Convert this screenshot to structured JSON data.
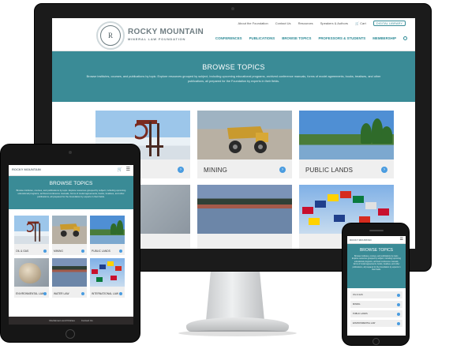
{
  "desktop": {
    "topbar": [
      "About the Foundation",
      "Contact Us",
      "Resources",
      "Speakers & Authors",
      "Cart"
    ],
    "digital_library": "DIGITAL LIBRARY",
    "logo": {
      "title": "ROCKY MOUNTAIN",
      "subtitle": "MINERAL LAW FOUNDATION",
      "monogram": "R"
    },
    "nav": [
      "CONFERENCES",
      "PUBLICATIONS",
      "BROWSE TOPICS",
      "PROFESSORS & STUDENTS",
      "MEMBERSHIP"
    ],
    "hero": {
      "title": "BROWSE TOPICS",
      "text": "Browse institutes, courses, and publications by topic. Explore resources grouped by subject, including upcoming educational programs, archived conference manuals, forms of model agreements, books, treatises, and other publications, all prepared for the Foundation by experts in their fields."
    },
    "cards": [
      {
        "label": ""
      },
      {
        "label": "MINING"
      },
      {
        "label": "PUBLIC LANDS"
      },
      {
        "label": ""
      },
      {
        "label": ""
      },
      {
        "label": ""
      }
    ]
  },
  "tablet": {
    "logo": "ROCKY MOUNTAIN",
    "hero": {
      "title": "BROWSE TOPICS",
      "text": "Browse institutes, courses, and publications by topic. Explore resources grouped by subject, including upcoming educational programs, archived conference manuals, forms of model agreements, books, treatises, and other publications, all prepared for the Foundation by experts in their fields."
    },
    "cards": [
      "OIL & GAS",
      "MINING",
      "PUBLIC LANDS",
      "ENVIRONMENTAL LAW",
      "WATER LAW",
      "INTERNATIONAL LAW"
    ],
    "footer": [
      "Disclaimers and Policies",
      "Contact Us"
    ]
  },
  "phone": {
    "logo": "ROCKY MOUNTAIN",
    "hero": {
      "title": "BROWSE TOPICS",
      "text": "Browse institutes, courses, and publications by topic. Explore resources grouped by subject, including upcoming educational programs, archived conference manuals, forms of model agreements, books, treatises, and other publications, all prepared for the Foundation by experts in their fields."
    },
    "items": [
      "OIL & GAS",
      "MINING",
      "PUBLIC LANDS",
      "ENVIRONMENTAL LAW"
    ]
  },
  "colors": {
    "teal": "#3a8b96",
    "button": "#4a9ce0"
  },
  "icons": {
    "cart": "cart-icon",
    "search": "search-icon",
    "menu": "hamburger-icon",
    "arrow": "arrow-right-icon"
  }
}
